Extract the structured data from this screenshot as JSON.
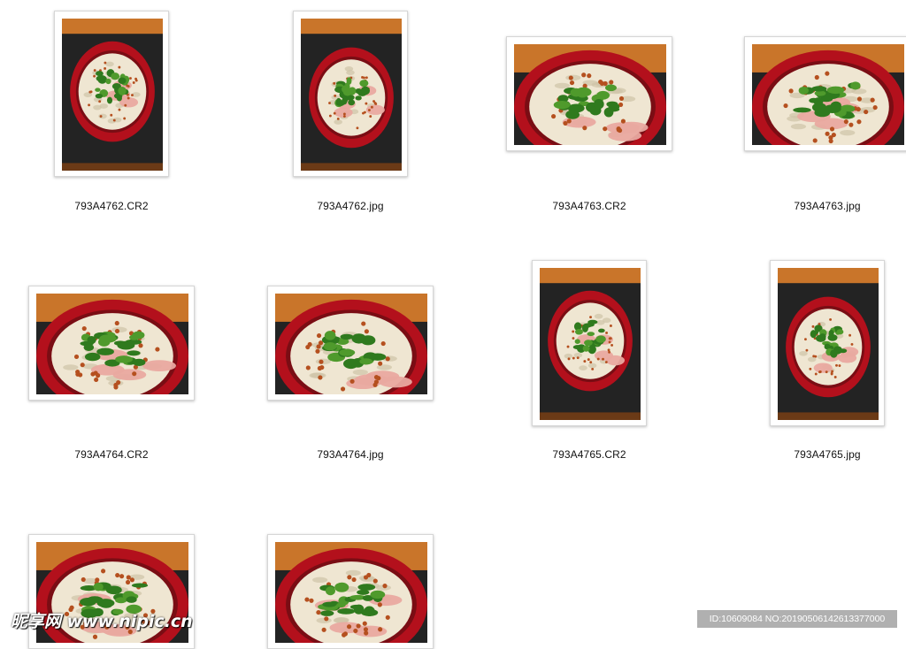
{
  "files": [
    {
      "name": "793A4762.CR2",
      "orientation": "portrait",
      "variant": "a"
    },
    {
      "name": "793A4762.jpg",
      "orientation": "portrait",
      "variant": "b"
    },
    {
      "name": "793A4763.CR2",
      "orientation": "landscape",
      "variant": "a"
    },
    {
      "name": "793A4763.jpg",
      "orientation": "landscape",
      "variant": "b"
    },
    {
      "name": "793A4764.CR2",
      "orientation": "landscape",
      "variant": "a"
    },
    {
      "name": "793A4764.jpg",
      "orientation": "landscape",
      "variant": "b"
    },
    {
      "name": "793A4765.CR2",
      "orientation": "portrait",
      "variant": "a"
    },
    {
      "name": "793A4765.jpg",
      "orientation": "portrait",
      "variant": "b"
    },
    {
      "name": "",
      "orientation": "landscape",
      "variant": "a"
    },
    {
      "name": "",
      "orientation": "landscape",
      "variant": "b"
    }
  ],
  "watermark": {
    "logo": "昵享网 www.nipic.cn",
    "id_text": "ID:10609084 NO:20190506142613377000"
  },
  "colors": {
    "table_dark": "#232323",
    "wood_orange": "#c9752a",
    "bowl_red": "#b3101c",
    "noodle": "#efe6d2",
    "herb_green": "#2f7a1e",
    "meat_pink": "#e9a9a0",
    "chili": "#b5501f"
  }
}
